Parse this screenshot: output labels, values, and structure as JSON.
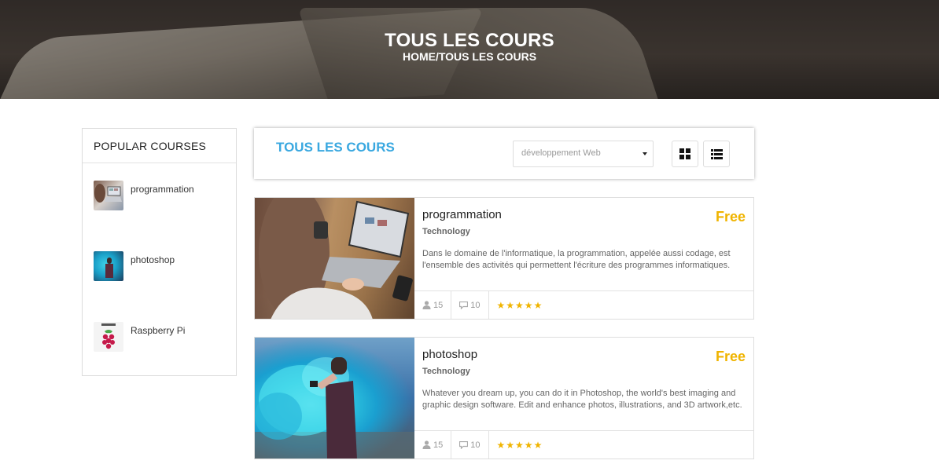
{
  "hero": {
    "title": "TOUS LES COURS",
    "breadcrumb": "HOME/TOUS LES COURS"
  },
  "sidebar": {
    "heading": "POPULAR COURSES",
    "items": [
      {
        "label": "programmation",
        "icon": "laptop-thumbnail"
      },
      {
        "label": "photoshop",
        "icon": "blue-smoke-thumbnail"
      },
      {
        "label": "Raspberry Pi",
        "icon": "raspberry-pi-logo"
      }
    ]
  },
  "toolbar": {
    "title": "TOUS LES COURS",
    "category_select": "développement Web",
    "grid_view_icon": "grid-icon",
    "list_view_icon": "list-icon"
  },
  "courses": [
    {
      "title": "programmation",
      "category": "Technology",
      "price": "Free",
      "description": "Dans le domaine de l'informatique, la programmation, appelée aussi codage, est l'ensemble des activités qui permettent l'écriture des programmes informatiques.",
      "students": "15",
      "comments": "10",
      "rating": 5
    },
    {
      "title": "photoshop",
      "category": "Technology",
      "price": "Free",
      "description": "Whatever you dream up, you can do it in Photoshop, the world's best imaging and graphic design software. Edit and enhance photos, illustrations, and 3D artwork,etc.",
      "students": "15",
      "comments": "10",
      "rating": 5
    }
  ],
  "colors": {
    "accent": "#3aa8e0",
    "price": "#f0b400",
    "stars": "#f0b400"
  }
}
